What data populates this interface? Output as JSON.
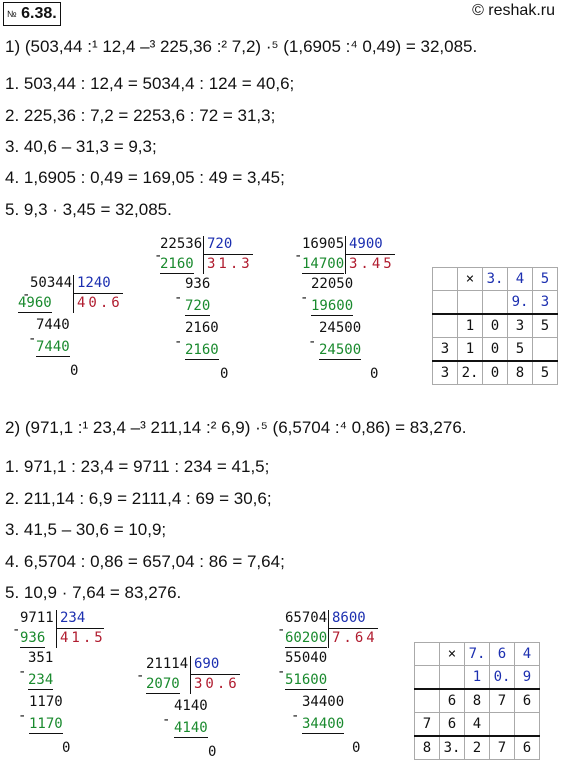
{
  "header": {
    "number": "6.38.",
    "number_prefix": "№",
    "site": "© reshak.ru"
  },
  "p1": {
    "expr": "1) (503,44 :¹ 12,4 –³ 225,36 :² 7,2) ·⁵ (1,6905 :⁴ 0,49) = 32,085.",
    "steps": [
      "1.  503,44 : 12,4 = 5034,4 : 124 = 40,6;",
      "2.  225,36 : 7,2 = 2253,6 : 72 = 31,3;",
      "3.  40,6 – 31,3 = 9,3;",
      "4.  1,6905 : 0,49 = 169,05 : 49 = 3,45;",
      "5.  9,3 · 3,45 = 32,085."
    ],
    "div1": {
      "dividend": "50344",
      "divisor": "1240",
      "quotient": "40.6",
      "rows": [
        "4960",
        "7440",
        "7440",
        "0"
      ]
    },
    "div2": {
      "dividend": "22536",
      "divisor": "720",
      "quotient": "31.3",
      "rows": [
        "2160",
        "936",
        "720",
        "2160",
        "2160",
        "0"
      ]
    },
    "div3": {
      "dividend": "16905",
      "divisor": "4900",
      "quotient": "3.45",
      "rows": [
        "14700",
        "22050",
        "19600",
        "24500",
        "24500",
        "0"
      ]
    },
    "mult": {
      "rows": [
        [
          "",
          "×",
          "3.",
          "4",
          "5"
        ],
        [
          "",
          "",
          "",
          "9.",
          "3"
        ],
        [
          "",
          "1",
          "0",
          "3",
          "5"
        ],
        [
          "3",
          "1",
          "0",
          "5",
          ""
        ],
        [
          "3",
          "2.",
          "0",
          "8",
          "5"
        ]
      ]
    }
  },
  "p2": {
    "expr": "2) (971,1 :¹ 23,4 –³ 211,14 :² 6,9) ·⁵ (6,5704 :⁴ 0,86) = 83,276.",
    "steps": [
      "1.  971,1 : 23,4 = 9711 : 234 = 41,5;",
      "2.  211,14 : 6,9 = 2111,4 : 69 = 30,6;",
      "3.  41,5 – 30,6 = 10,9;",
      "4.  6,5704 : 0,86 = 657,04 : 86 = 7,64;",
      "5.  10,9 · 7,64 = 83,276."
    ],
    "div1": {
      "dividend": "9711",
      "divisor": "234",
      "quotient": "41.5",
      "rows": [
        "936",
        "351",
        "234",
        "1170",
        "1170",
        "0"
      ]
    },
    "div2": {
      "dividend": "21114",
      "divisor": "690",
      "quotient": "30.6",
      "rows": [
        "2070",
        "4140",
        "4140",
        "0"
      ]
    },
    "div3": {
      "dividend": "65704",
      "divisor": "8600",
      "quotient": "7.64",
      "rows": [
        "60200",
        "55040",
        "51600",
        "34400",
        "34400",
        "0"
      ]
    },
    "mult": {
      "rows": [
        [
          "",
          "×",
          "7.",
          "6",
          "4"
        ],
        [
          "",
          "",
          "1",
          "0.",
          "9"
        ],
        [
          "",
          "6",
          "8",
          "7",
          "6"
        ],
        [
          "7",
          "6",
          "4",
          "",
          ""
        ],
        [
          "8",
          "3.",
          "2",
          "7",
          "6"
        ]
      ]
    }
  }
}
